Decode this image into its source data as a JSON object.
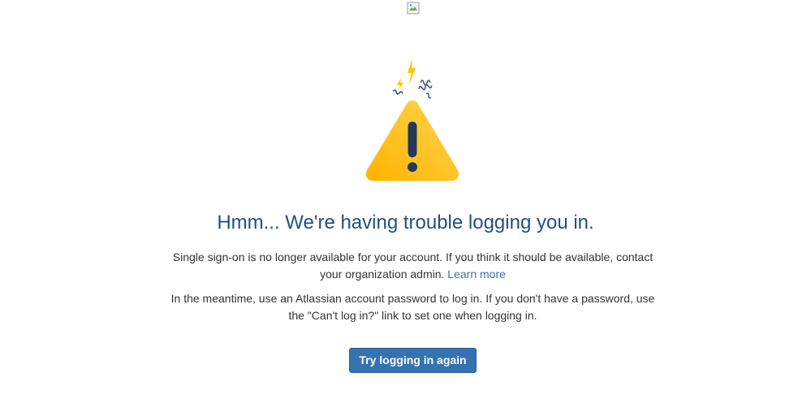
{
  "header": {
    "logo_image": "broken-image-icon"
  },
  "illustration": {
    "icon": "warning-triangle-icon",
    "colors": {
      "triangle_light": "#FFD54F",
      "triangle_dark": "#FFB300",
      "exclamation": "#253858",
      "spark": "#FFC400",
      "squiggle": "#42526E"
    }
  },
  "main": {
    "heading": "Hmm... We're having trouble logging you in.",
    "paragraph1_text": "Single sign-on is no longer available for your account. If you think it should be available, contact your organization admin. ",
    "learn_more_link": "Learn more",
    "paragraph2_text": "In the meantime, use an Atlassian account password to log in. If you don't have a password, use the \"Can't log in?\" link to set one when logging in.",
    "retry_button": "Try logging in again"
  },
  "colors": {
    "heading": "#205081",
    "link": "#3572b0",
    "button_bg": "#3572b0",
    "button_text": "#ffffff"
  }
}
